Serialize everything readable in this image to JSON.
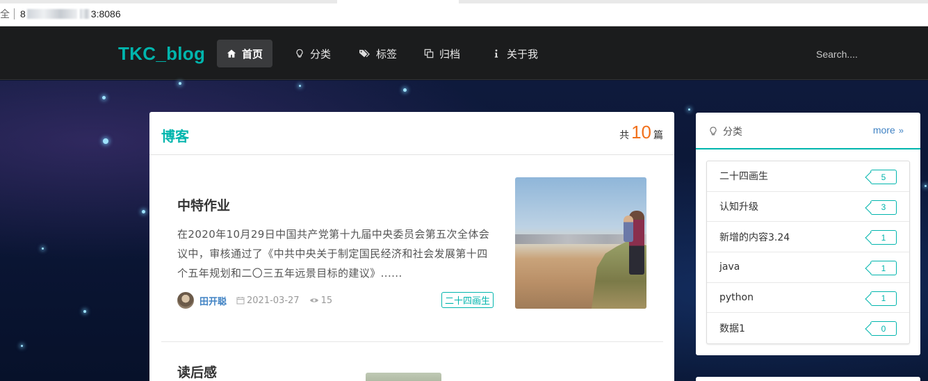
{
  "browser": {
    "address_prefix": "8",
    "address_suffix": "3:8086"
  },
  "navbar": {
    "brand": "TKC_blog",
    "items": [
      {
        "label": "首页",
        "icon": "home-icon",
        "active": true
      },
      {
        "label": "分类",
        "icon": "lightbulb-icon",
        "active": false
      },
      {
        "label": "标签",
        "icon": "tags-icon",
        "active": false
      },
      {
        "label": "归档",
        "icon": "clone-icon",
        "active": false
      },
      {
        "label": "关于我",
        "icon": "info-icon",
        "active": false
      }
    ],
    "search_placeholder": "Search...."
  },
  "blog": {
    "title": "博客",
    "count_prefix": "共",
    "count": "10",
    "count_suffix": "篇",
    "posts": [
      {
        "title": "中特作业",
        "excerpt": "在2020年10月29日中国共产党第十九届中央委员会第五次全体会议中，审核通过了《中共中央关于制定国民经济和社会发展第十四个五年规划和二〇三五年远景目标的建议》......",
        "author": "田开聪",
        "date": "2021-03-27",
        "views": "15",
        "tag": "二十四画生"
      },
      {
        "title": "读后感"
      }
    ]
  },
  "categories": {
    "title": "分类",
    "more_label": "more",
    "items": [
      {
        "name": "二十四画生",
        "count": "5"
      },
      {
        "name": "认知升级",
        "count": "3"
      },
      {
        "name": "新增的内容3.24",
        "count": "1"
      },
      {
        "name": "java",
        "count": "1"
      },
      {
        "name": "python",
        "count": "1"
      },
      {
        "name": "数据1",
        "count": "0"
      }
    ]
  },
  "colors": {
    "accent": "#00b5ad",
    "count_orange": "#f2711c",
    "link_blue": "#4183c4",
    "navbar_bg": "#1b1c1d"
  }
}
